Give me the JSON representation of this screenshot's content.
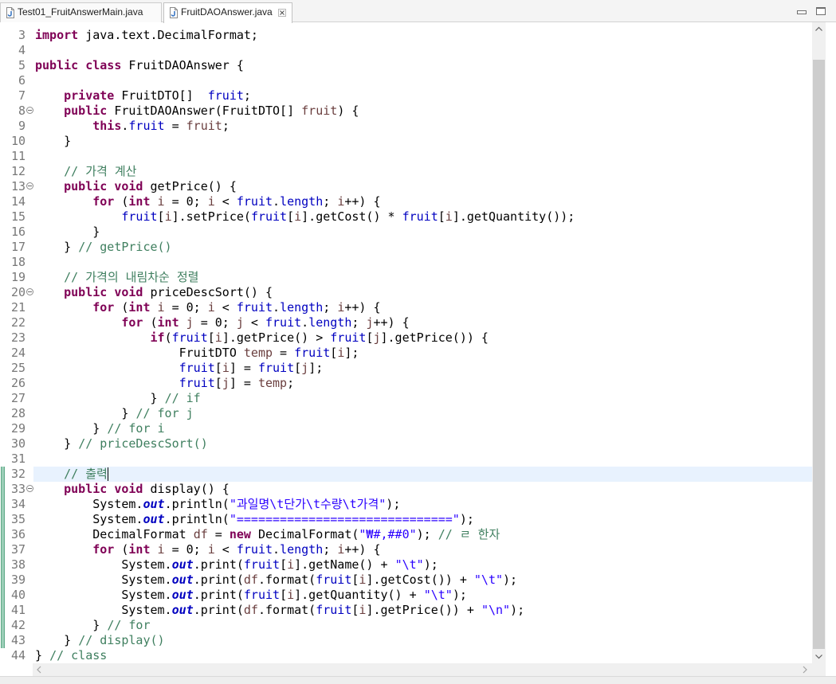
{
  "window_controls": {
    "minimize_icon": "minimize-icon",
    "maximize_icon": "maximize-icon"
  },
  "tabs": [
    {
      "label": "Test01_FruitAnswerMain.java",
      "icon": "java-file-icon",
      "active": false
    },
    {
      "label": "FruitDAOAnswer.java",
      "icon": "java-file-icon",
      "active": true,
      "close_icon": "close-icon"
    }
  ],
  "editor": {
    "syntax_colors": {
      "k": "#7f0055",
      "f": "#0000c0",
      "o": "#0000c0",
      "v": "#6a3e3e",
      "s": "#2a00ff",
      "c": "#3f7f5f",
      "p": "#000000"
    },
    "current_line_color": "#e8f2fe",
    "change_marker_color": "#9ccfb8",
    "lines": [
      {
        "n": "3",
        "code": [
          {
            "k": "import"
          },
          {
            "p": " java.text.DecimalFormat;"
          }
        ]
      },
      {
        "n": "4",
        "code": []
      },
      {
        "n": "5",
        "code": [
          {
            "k": "public"
          },
          {
            "p": " "
          },
          {
            "k": "class"
          },
          {
            "p": " FruitDAOAnswer {"
          }
        ]
      },
      {
        "n": "6",
        "code": []
      },
      {
        "n": "7",
        "code": [
          {
            "p": "    "
          },
          {
            "k": "private"
          },
          {
            "p": " FruitDTO[]  "
          },
          {
            "f": "fruit"
          },
          {
            "p": ";"
          }
        ]
      },
      {
        "n": "8",
        "fold": true,
        "code": [
          {
            "p": "    "
          },
          {
            "k": "public"
          },
          {
            "p": " FruitDAOAnswer(FruitDTO[] "
          },
          {
            "v": "fruit"
          },
          {
            "p": ") {"
          }
        ]
      },
      {
        "n": "9",
        "code": [
          {
            "p": "        "
          },
          {
            "k": "this"
          },
          {
            "p": "."
          },
          {
            "f": "fruit"
          },
          {
            "p": " = "
          },
          {
            "v": "fruit"
          },
          {
            "p": ";"
          }
        ]
      },
      {
        "n": "10",
        "code": [
          {
            "p": "    }"
          }
        ]
      },
      {
        "n": "11",
        "code": []
      },
      {
        "n": "12",
        "code": [
          {
            "p": "    "
          },
          {
            "c": "// 가격 계산"
          }
        ]
      },
      {
        "n": "13",
        "fold": true,
        "code": [
          {
            "p": "    "
          },
          {
            "k": "public"
          },
          {
            "p": " "
          },
          {
            "k": "void"
          },
          {
            "p": " getPrice() {"
          }
        ]
      },
      {
        "n": "14",
        "code": [
          {
            "p": "        "
          },
          {
            "k": "for"
          },
          {
            "p": " ("
          },
          {
            "k": "int"
          },
          {
            "p": " "
          },
          {
            "v": "i"
          },
          {
            "p": " = 0; "
          },
          {
            "v": "i"
          },
          {
            "p": " < "
          },
          {
            "f": "fruit"
          },
          {
            "p": "."
          },
          {
            "f": "length"
          },
          {
            "p": "; "
          },
          {
            "v": "i"
          },
          {
            "p": "++) {"
          }
        ]
      },
      {
        "n": "15",
        "code": [
          {
            "p": "            "
          },
          {
            "f": "fruit"
          },
          {
            "p": "["
          },
          {
            "v": "i"
          },
          {
            "p": "].setPrice("
          },
          {
            "f": "fruit"
          },
          {
            "p": "["
          },
          {
            "v": "i"
          },
          {
            "p": "].getCost() * "
          },
          {
            "f": "fruit"
          },
          {
            "p": "["
          },
          {
            "v": "i"
          },
          {
            "p": "].getQuantity());"
          }
        ]
      },
      {
        "n": "16",
        "code": [
          {
            "p": "        }"
          }
        ]
      },
      {
        "n": "17",
        "code": [
          {
            "p": "    } "
          },
          {
            "c": "// getPrice()"
          }
        ]
      },
      {
        "n": "18",
        "code": []
      },
      {
        "n": "19",
        "code": [
          {
            "p": "    "
          },
          {
            "c": "// 가격의 내림차순 정렬"
          }
        ]
      },
      {
        "n": "20",
        "fold": true,
        "code": [
          {
            "p": "    "
          },
          {
            "k": "public"
          },
          {
            "p": " "
          },
          {
            "k": "void"
          },
          {
            "p": " priceDescSort() {"
          }
        ]
      },
      {
        "n": "21",
        "code": [
          {
            "p": "        "
          },
          {
            "k": "for"
          },
          {
            "p": " ("
          },
          {
            "k": "int"
          },
          {
            "p": " "
          },
          {
            "v": "i"
          },
          {
            "p": " = 0; "
          },
          {
            "v": "i"
          },
          {
            "p": " < "
          },
          {
            "f": "fruit"
          },
          {
            "p": "."
          },
          {
            "f": "length"
          },
          {
            "p": "; "
          },
          {
            "v": "i"
          },
          {
            "p": "++) {"
          }
        ]
      },
      {
        "n": "22",
        "code": [
          {
            "p": "            "
          },
          {
            "k": "for"
          },
          {
            "p": " ("
          },
          {
            "k": "int"
          },
          {
            "p": " "
          },
          {
            "v": "j"
          },
          {
            "p": " = 0; "
          },
          {
            "v": "j"
          },
          {
            "p": " < "
          },
          {
            "f": "fruit"
          },
          {
            "p": "."
          },
          {
            "f": "length"
          },
          {
            "p": "; "
          },
          {
            "v": "j"
          },
          {
            "p": "++) {"
          }
        ]
      },
      {
        "n": "23",
        "code": [
          {
            "p": "                "
          },
          {
            "k": "if"
          },
          {
            "p": "("
          },
          {
            "f": "fruit"
          },
          {
            "p": "["
          },
          {
            "v": "i"
          },
          {
            "p": "].getPrice() > "
          },
          {
            "f": "fruit"
          },
          {
            "p": "["
          },
          {
            "v": "j"
          },
          {
            "p": "].getPrice()) {"
          }
        ]
      },
      {
        "n": "24",
        "code": [
          {
            "p": "                    FruitDTO "
          },
          {
            "v": "temp"
          },
          {
            "p": " = "
          },
          {
            "f": "fruit"
          },
          {
            "p": "["
          },
          {
            "v": "i"
          },
          {
            "p": "];"
          }
        ]
      },
      {
        "n": "25",
        "code": [
          {
            "p": "                    "
          },
          {
            "f": "fruit"
          },
          {
            "p": "["
          },
          {
            "v": "i"
          },
          {
            "p": "] = "
          },
          {
            "f": "fruit"
          },
          {
            "p": "["
          },
          {
            "v": "j"
          },
          {
            "p": "];"
          }
        ]
      },
      {
        "n": "26",
        "code": [
          {
            "p": "                    "
          },
          {
            "f": "fruit"
          },
          {
            "p": "["
          },
          {
            "v": "j"
          },
          {
            "p": "] = "
          },
          {
            "v": "temp"
          },
          {
            "p": ";"
          }
        ]
      },
      {
        "n": "27",
        "code": [
          {
            "p": "                } "
          },
          {
            "c": "// if"
          }
        ]
      },
      {
        "n": "28",
        "code": [
          {
            "p": "            } "
          },
          {
            "c": "// for j"
          }
        ]
      },
      {
        "n": "29",
        "code": [
          {
            "p": "        } "
          },
          {
            "c": "// for i"
          }
        ]
      },
      {
        "n": "30",
        "code": [
          {
            "p": "    } "
          },
          {
            "c": "// priceDescSort()"
          }
        ]
      },
      {
        "n": "31",
        "code": []
      },
      {
        "n": "32",
        "current": true,
        "cursor": true,
        "changed": true,
        "code": [
          {
            "p": "    "
          },
          {
            "c": "// 출력"
          }
        ]
      },
      {
        "n": "33",
        "fold": true,
        "changed": true,
        "code": [
          {
            "p": "    "
          },
          {
            "k": "public"
          },
          {
            "p": " "
          },
          {
            "k": "void"
          },
          {
            "p": " display() {"
          }
        ]
      },
      {
        "n": "34",
        "changed": true,
        "code": [
          {
            "p": "        System."
          },
          {
            "o": "out"
          },
          {
            "p": ".println("
          },
          {
            "s": "\"과일명\\t단가\\t수량\\t가격\""
          },
          {
            "p": ");"
          }
        ]
      },
      {
        "n": "35",
        "changed": true,
        "code": [
          {
            "p": "        System."
          },
          {
            "o": "out"
          },
          {
            "p": ".println("
          },
          {
            "s": "\"==============================\""
          },
          {
            "p": ");"
          }
        ]
      },
      {
        "n": "36",
        "changed": true,
        "code": [
          {
            "p": "        DecimalFormat "
          },
          {
            "v": "df"
          },
          {
            "p": " = "
          },
          {
            "k": "new"
          },
          {
            "p": " DecimalFormat("
          },
          {
            "s": "\"₩#,##0\""
          },
          {
            "p": "); "
          },
          {
            "c": "// ㄹ 한자"
          }
        ]
      },
      {
        "n": "37",
        "changed": true,
        "code": [
          {
            "p": "        "
          },
          {
            "k": "for"
          },
          {
            "p": " ("
          },
          {
            "k": "int"
          },
          {
            "p": " "
          },
          {
            "v": "i"
          },
          {
            "p": " = 0; "
          },
          {
            "v": "i"
          },
          {
            "p": " < "
          },
          {
            "f": "fruit"
          },
          {
            "p": "."
          },
          {
            "f": "length"
          },
          {
            "p": "; "
          },
          {
            "v": "i"
          },
          {
            "p": "++) {"
          }
        ]
      },
      {
        "n": "38",
        "changed": true,
        "code": [
          {
            "p": "            System."
          },
          {
            "o": "out"
          },
          {
            "p": ".print("
          },
          {
            "f": "fruit"
          },
          {
            "p": "["
          },
          {
            "v": "i"
          },
          {
            "p": "].getName() + "
          },
          {
            "s": "\"\\t\""
          },
          {
            "p": ");"
          }
        ]
      },
      {
        "n": "39",
        "changed": true,
        "code": [
          {
            "p": "            System."
          },
          {
            "o": "out"
          },
          {
            "p": ".print("
          },
          {
            "v": "df"
          },
          {
            "p": ".format("
          },
          {
            "f": "fruit"
          },
          {
            "p": "["
          },
          {
            "v": "i"
          },
          {
            "p": "].getCost()) + "
          },
          {
            "s": "\"\\t\""
          },
          {
            "p": ");"
          }
        ]
      },
      {
        "n": "40",
        "changed": true,
        "code": [
          {
            "p": "            System."
          },
          {
            "o": "out"
          },
          {
            "p": ".print("
          },
          {
            "f": "fruit"
          },
          {
            "p": "["
          },
          {
            "v": "i"
          },
          {
            "p": "].getQuantity() + "
          },
          {
            "s": "\"\\t\""
          },
          {
            "p": ");"
          }
        ]
      },
      {
        "n": "41",
        "changed": true,
        "code": [
          {
            "p": "            System."
          },
          {
            "o": "out"
          },
          {
            "p": ".print("
          },
          {
            "v": "df"
          },
          {
            "p": ".format("
          },
          {
            "f": "fruit"
          },
          {
            "p": "["
          },
          {
            "v": "i"
          },
          {
            "p": "].getPrice()) + "
          },
          {
            "s": "\"\\n\""
          },
          {
            "p": ");"
          }
        ]
      },
      {
        "n": "42",
        "changed": true,
        "code": [
          {
            "p": "        } "
          },
          {
            "c": "// for"
          }
        ]
      },
      {
        "n": "43",
        "changed": true,
        "code": [
          {
            "p": "    } "
          },
          {
            "c": "// display()"
          }
        ]
      },
      {
        "n": "44",
        "code": [
          {
            "p": "} "
          },
          {
            "c": "// class"
          }
        ]
      }
    ]
  },
  "scrollbars": {
    "up_icon": "chevron-up-icon",
    "down_icon": "chevron-down-icon",
    "left_icon": "chevron-left-icon",
    "right_icon": "chevron-right-icon"
  }
}
